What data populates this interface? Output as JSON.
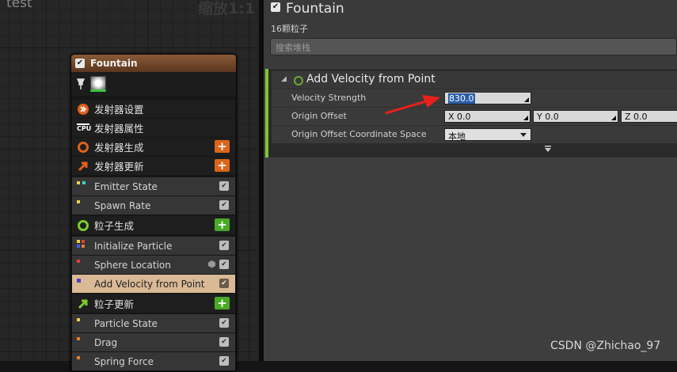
{
  "graph": {
    "title": "test",
    "zoom": "缩放1:1"
  },
  "emitter": {
    "name": "Fountain",
    "sections": [
      {
        "label": "发射器设置",
        "type": "section"
      },
      {
        "label": "发射器属性",
        "type": "section"
      },
      {
        "label": "发射器生成",
        "type": "section"
      },
      {
        "label": "发射器更新",
        "type": "section"
      },
      {
        "label": "Emitter State",
        "type": "module"
      },
      {
        "label": "Spawn Rate",
        "type": "module"
      },
      {
        "label": "粒子生成",
        "type": "section"
      },
      {
        "label": "Initialize Particle",
        "type": "module"
      },
      {
        "label": "Sphere Location",
        "type": "module"
      },
      {
        "label": "Add Velocity from Point",
        "type": "module",
        "selected": true
      },
      {
        "label": "粒子更新",
        "type": "section"
      },
      {
        "label": "Particle State",
        "type": "module"
      },
      {
        "label": "Drag",
        "type": "module"
      },
      {
        "label": "Spring Force",
        "type": "module"
      }
    ],
    "cpu_label": "CPU",
    "plus": "+"
  },
  "details": {
    "title": "Fountain",
    "subtitle": "16颗粒子",
    "search_placeholder": "搜索堆栈",
    "module_title": "Add Velocity from Point",
    "params": {
      "velocity_strength_label": "Velocity Strength",
      "velocity_strength_value": "830.0",
      "origin_offset_label": "Origin Offset",
      "x": "X 0.0",
      "y": "Y 0.0",
      "z": "Z 0.0",
      "space_label": "Origin Offset Coordinate Space",
      "space_value": "本地"
    }
  },
  "watermark": "CSDN @Zhichao_97",
  "colors": {
    "accent_green": "#78c832",
    "orange": "#d9661a",
    "selected_row": "#d9b996"
  }
}
